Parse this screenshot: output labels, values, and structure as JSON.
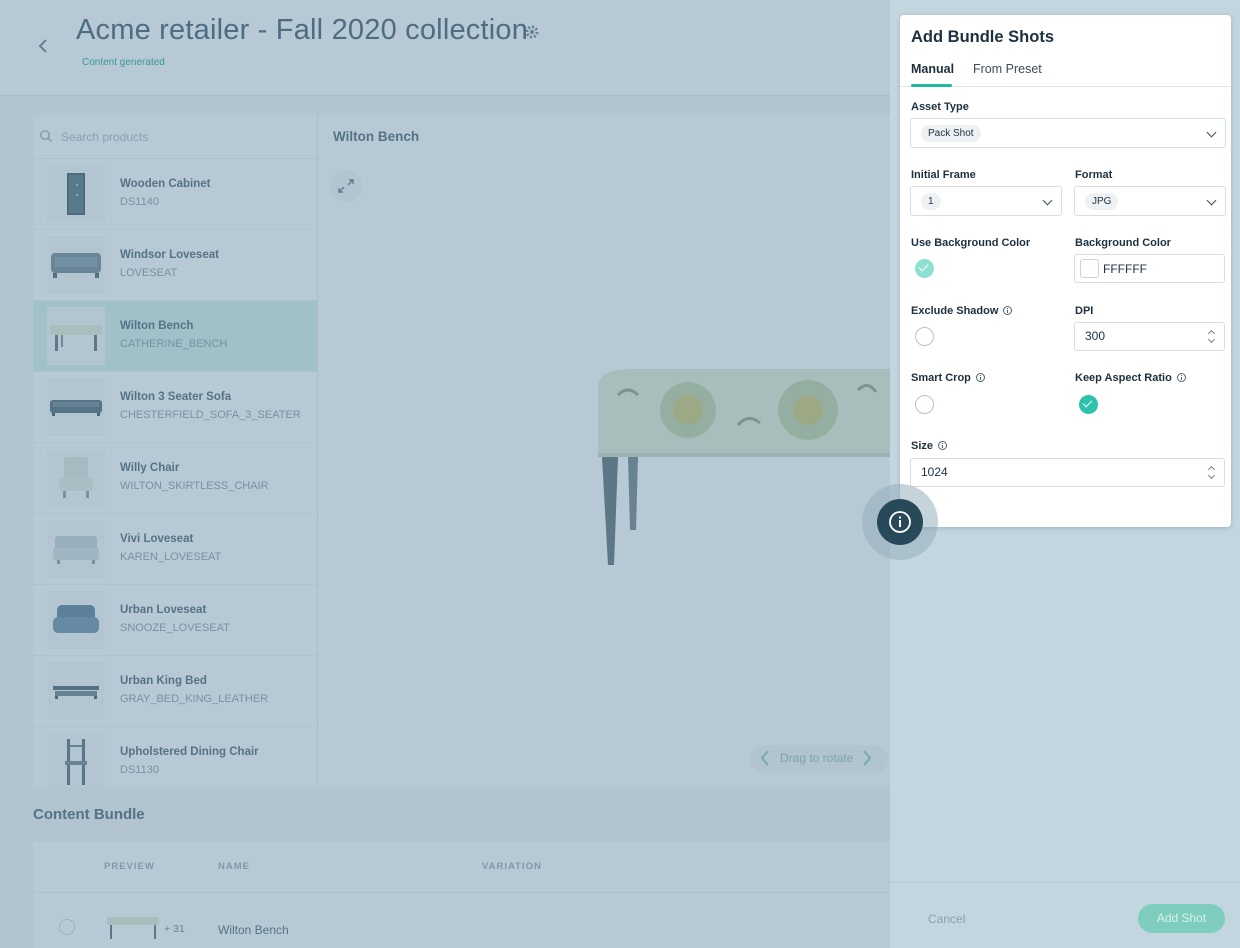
{
  "header": {
    "title": "Acme retailer - Fall 2020 collection",
    "status": "Content generated"
  },
  "search": {
    "placeholder": "Search products"
  },
  "products": [
    {
      "name": "Wooden Cabinet",
      "sku": "DS1140"
    },
    {
      "name": "Windsor Loveseat",
      "sku": "LOVESEAT"
    },
    {
      "name": "Wilton Bench",
      "sku": "CATHERINE_BENCH"
    },
    {
      "name": "Wilton 3 Seater Sofa",
      "sku": "CHESTERFIELD_SOFA_3_SEATER"
    },
    {
      "name": "Willy Chair",
      "sku": "WILTON_SKIRTLESS_CHAIR"
    },
    {
      "name": "Vivi Loveseat",
      "sku": "KAREN_LOVESEAT"
    },
    {
      "name": "Urban Loveseat",
      "sku": "SNOOZE_LOVESEAT"
    },
    {
      "name": "Urban King Bed",
      "sku": "GRAY_BED_KING_LEATHER"
    },
    {
      "name": "Upholstered Dining Chair",
      "sku": "DS1130"
    }
  ],
  "viewer": {
    "title": "Wilton Bench",
    "rotate_hint": "Drag to rotate"
  },
  "bundle": {
    "title": "Content Bundle",
    "columns": [
      "PREVIEW",
      "NAME",
      "VARIATION"
    ],
    "row": {
      "count": "+ 31",
      "name": "Wilton Bench"
    }
  },
  "drawer": {
    "title": "Add Bundle Shots",
    "tabs": [
      "Manual",
      "From Preset"
    ],
    "active_tab": "Manual",
    "asset_type": {
      "label": "Asset Type",
      "value": "Pack Shot"
    },
    "initial_frame": {
      "label": "Initial Frame",
      "value": "1"
    },
    "format": {
      "label": "Format",
      "value": "JPG"
    },
    "use_bg_color": {
      "label": "Use Background Color",
      "checked": true
    },
    "bg_color": {
      "label": "Background Color",
      "value": "FFFFFF",
      "swatch": "#ffffff"
    },
    "exclude_shadow": {
      "label": "Exclude Shadow",
      "checked": false
    },
    "dpi": {
      "label": "DPI",
      "value": "300"
    },
    "smart_crop": {
      "label": "Smart Crop",
      "checked": false
    },
    "keep_aspect": {
      "label": "Keep Aspect Ratio",
      "checked": true
    },
    "size": {
      "label": "Size",
      "value": "1024"
    },
    "cancel_label": "Cancel",
    "add_label": "Add Shot"
  },
  "colors": {
    "accent": "#2ec2ad",
    "drawer_bg": "#c3d5de",
    "fab": "#28495a"
  },
  "icons": [
    "back-arrow-icon",
    "gear-icon",
    "search-icon",
    "expand-icon",
    "chevron-down-icon",
    "info-icon",
    "check-icon"
  ]
}
